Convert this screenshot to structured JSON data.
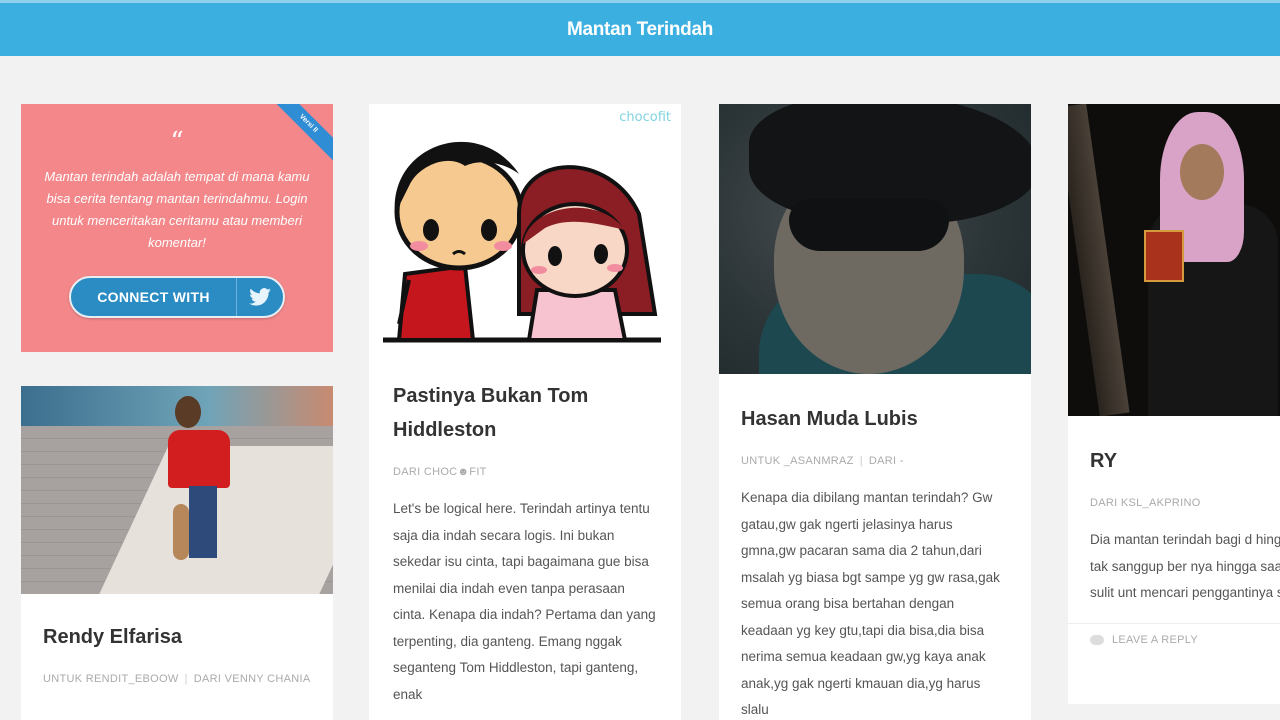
{
  "site": {
    "title": "Mantan Terindah"
  },
  "intro": {
    "quote_mark": "“",
    "text": "Mantan terindah adalah tempat di mana kamu bisa cerita tentang mantan terindahmu. Login untuk menceritakan ceritamu atau memberi komentar!",
    "ribbon": "Versi II",
    "connect_label": "CONNECT WITH",
    "connect_icon": "twitter-icon",
    "card_color": "#f3878a",
    "button_color": "#2b8cc4"
  },
  "posts": [
    {
      "title": "Rendy Elfarisa",
      "meta_untuk": "UNTUK RENDIT_EBOOW",
      "meta_dari": "DARI VENNY CHANIA"
    },
    {
      "title": "Pastinya Bukan Tom Hiddleston",
      "image_watermark": "chocofit",
      "meta_dari": "DARI CHOC☻FIT",
      "excerpt": "Let's be logical here. Terindah artinya tentu saja dia indah secara logis. Ini bukan sekedar isu cinta, tapi bagaimana gue bisa menilai dia indah even tanpa perasaan cinta. Kenapa dia indah? Pertama dan yang terpenting, dia ganteng. Emang nggak seganteng Tom Hiddleston, tapi ganteng, enak"
    },
    {
      "title": "Hasan Muda Lubis",
      "meta_untuk": "UNTUK _ASANMRAZ",
      "meta_dari": "DARI -",
      "excerpt": "Kenapa dia dibilang mantan terindah? Gw gatau,gw gak ngerti jelasinya harus gmna,gw pacaran sama dia 2 tahun,dari msalah yg biasa bgt sampe yg gw rasa,gak semua orang bisa bertahan dengan keadaan yg key gtu,tapi dia bisa,dia bisa nerima semua keadaan gw,yg kaya anak anak,yg gak ngerti kmauan dia,yg harus slalu"
    },
    {
      "title": "RY",
      "meta_dari": "DARI KSL_AKPRINO",
      "excerpt": "Dia mantan terindah bagi d hingga aku tak sanggup ber nya hingga saat ini sulit unt mencari penggantinya sepe",
      "reply_label": "LEAVE A REPLY"
    }
  ],
  "colors": {
    "topbar": "#3bafe0",
    "background": "#f2f2f2"
  }
}
